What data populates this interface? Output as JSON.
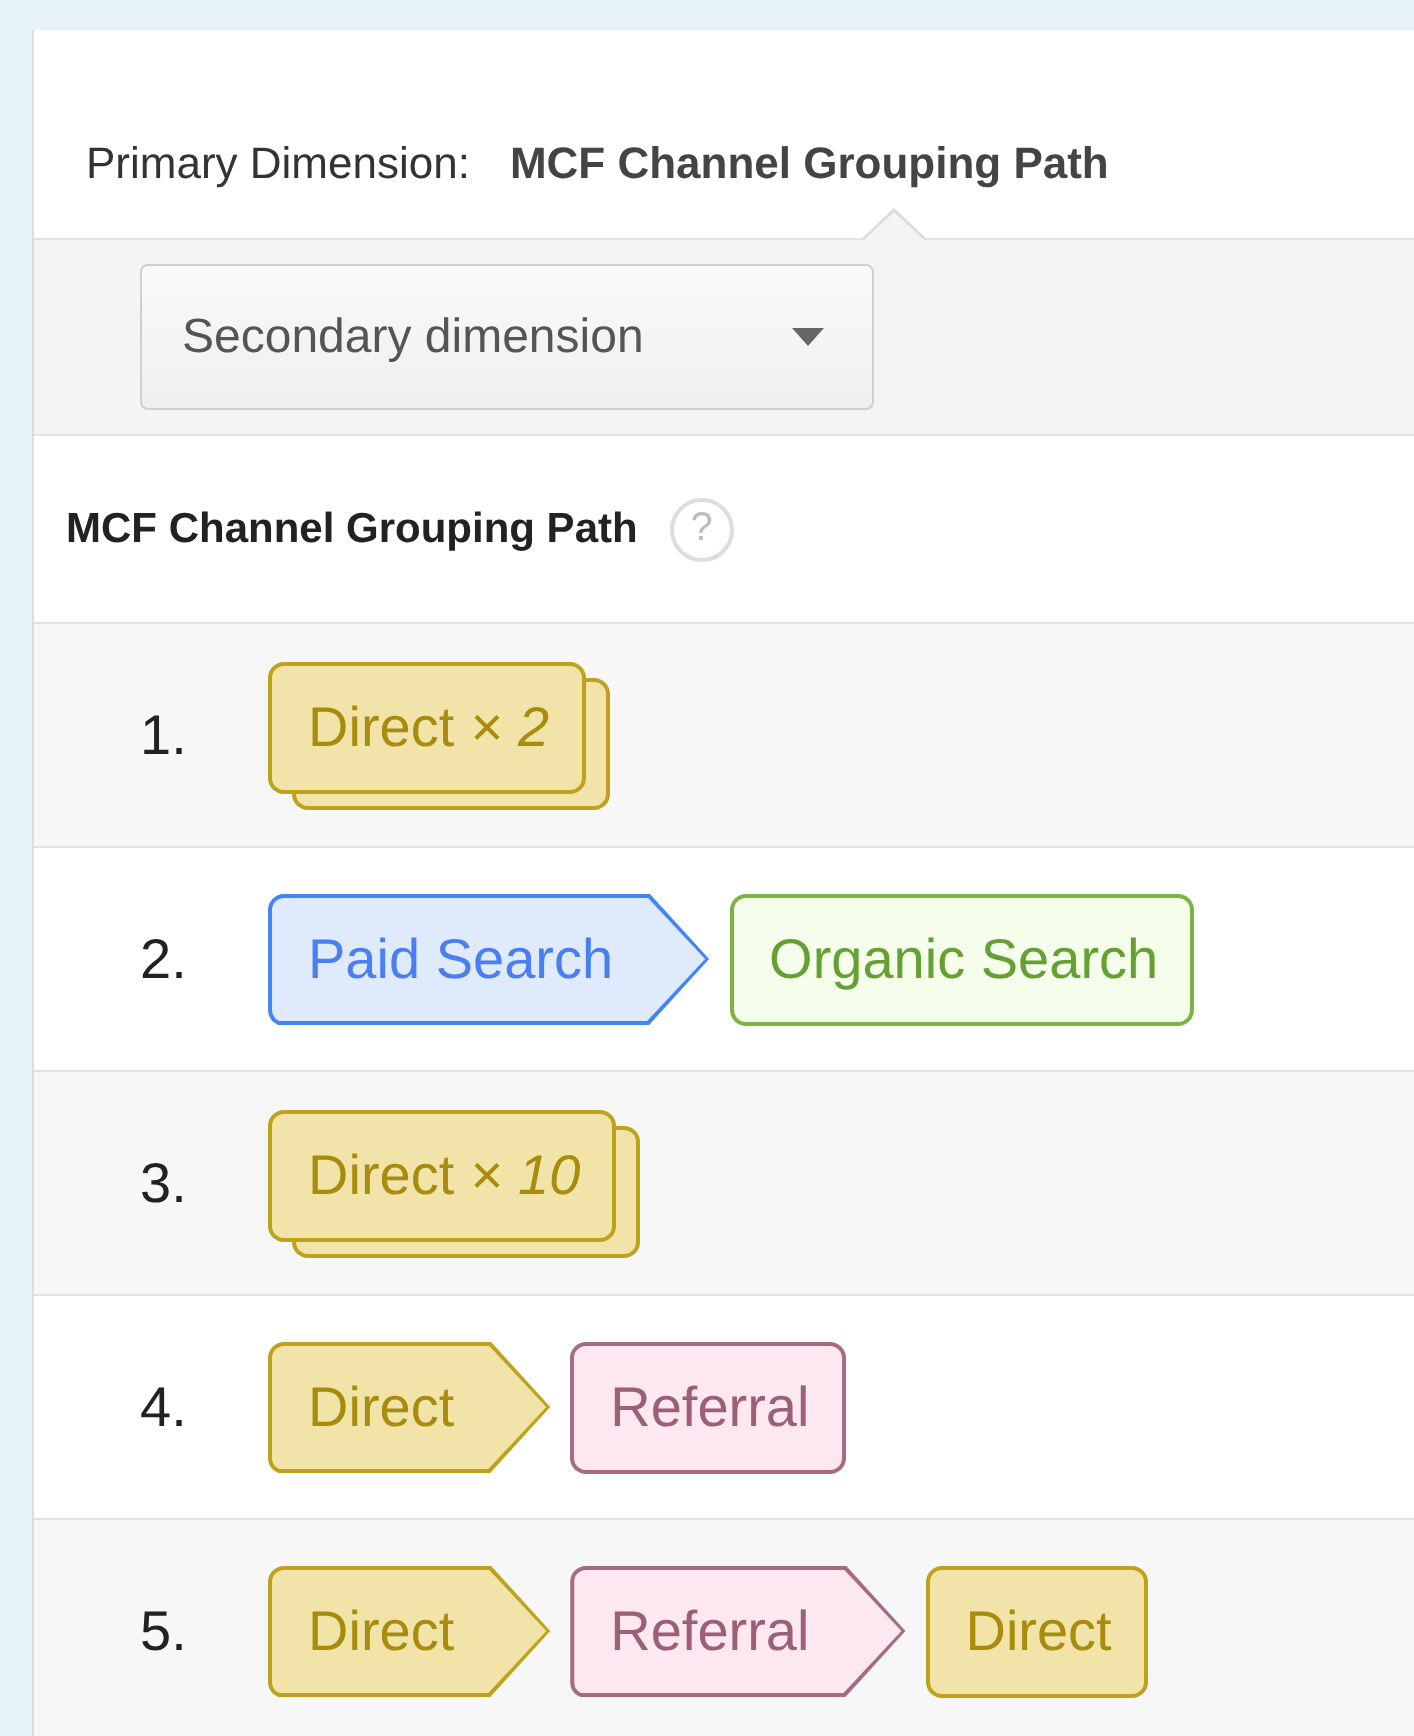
{
  "primary_dimension": {
    "label": "Primary Dimension:",
    "value": "MCF Channel Grouping Path"
  },
  "secondary_dimension": {
    "label": "Secondary dimension"
  },
  "table": {
    "column": "MCF Channel Grouping Path",
    "help": "?",
    "rows": [
      {
        "index": "1.",
        "steps": [
          {
            "text": "Direct *× 2*",
            "kind": "direct",
            "repeated": true
          }
        ]
      },
      {
        "index": "2.",
        "steps": [
          {
            "text": "Paid Search",
            "kind": "paid",
            "repeated": false
          },
          {
            "text": "Organic Search",
            "kind": "organic",
            "repeated": false
          }
        ]
      },
      {
        "index": "3.",
        "steps": [
          {
            "text": "Direct *× 10*",
            "kind": "direct",
            "repeated": true
          }
        ]
      },
      {
        "index": "4.",
        "steps": [
          {
            "text": "Direct",
            "kind": "direct",
            "repeated": false
          },
          {
            "text": "Referral",
            "kind": "referral",
            "repeated": false
          }
        ]
      },
      {
        "index": "5.",
        "steps": [
          {
            "text": "Direct",
            "kind": "direct",
            "repeated": false
          },
          {
            "text": "Referral",
            "kind": "referral",
            "repeated": false
          },
          {
            "text": "Direct",
            "kind": "direct",
            "repeated": false
          }
        ]
      }
    ]
  }
}
